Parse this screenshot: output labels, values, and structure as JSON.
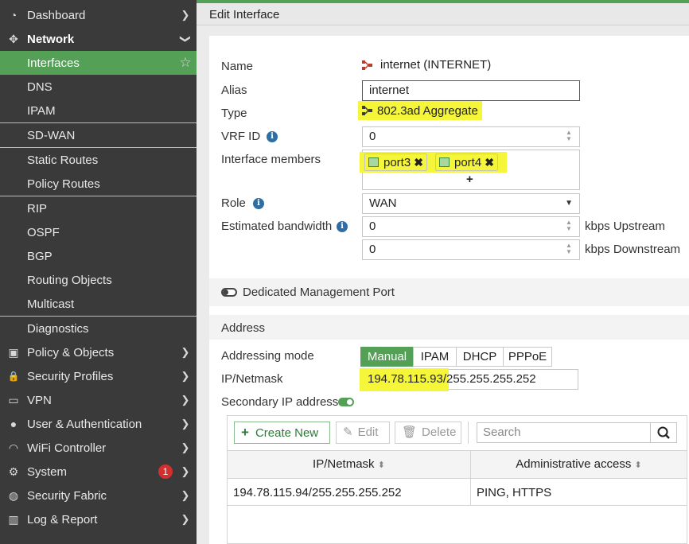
{
  "sidebar": {
    "items": [
      {
        "label": "Dashboard",
        "icon": "dashboard-icon",
        "glyph": "◔"
      },
      {
        "label": "Network",
        "icon": "network-icon",
        "glyph": "✥"
      },
      {
        "label": "Interfaces"
      },
      {
        "label": "DNS"
      },
      {
        "label": "IPAM"
      },
      {
        "label": "SD-WAN"
      },
      {
        "label": "Static Routes"
      },
      {
        "label": "Policy Routes"
      },
      {
        "label": "RIP"
      },
      {
        "label": "OSPF"
      },
      {
        "label": "BGP"
      },
      {
        "label": "Routing Objects"
      },
      {
        "label": "Multicast"
      },
      {
        "label": "Diagnostics"
      },
      {
        "label": "Policy & Objects",
        "icon": "policy-objects-icon",
        "glyph": "▣"
      },
      {
        "label": "Security Profiles",
        "icon": "lock-icon",
        "glyph": "🔒"
      },
      {
        "label": "VPN",
        "icon": "laptop-icon",
        "glyph": "▭"
      },
      {
        "label": "User & Authentication",
        "icon": "user-icon",
        "glyph": "●"
      },
      {
        "label": "WiFi Controller",
        "icon": "wifi-icon",
        "glyph": "◠"
      },
      {
        "label": "System",
        "icon": "gear-icon",
        "glyph": "⚙",
        "badge": "1"
      },
      {
        "label": "Security Fabric",
        "icon": "fabric-icon",
        "glyph": "◍"
      },
      {
        "label": "Log & Report",
        "icon": "bar-chart-icon",
        "glyph": "▥"
      }
    ],
    "favorite_icon": "star-icon",
    "accent": "#53a056"
  },
  "header": {
    "title": "Edit Interface"
  },
  "form": {
    "name_label": "Name",
    "name_value": "internet (INTERNET)",
    "alias_label": "Alias",
    "alias_value": "internet",
    "type_label": "Type",
    "type_value": "802.3ad Aggregate",
    "vrf_label": "VRF ID",
    "vrf_value": "0",
    "members_label": "Interface members",
    "members": [
      "port3",
      "port4"
    ],
    "add_glyph": "+",
    "role_label": "Role",
    "role_value": "WAN",
    "bandwidth_label": "Estimated bandwidth",
    "upstream_value": "0",
    "upstream_unit": "kbps Upstream",
    "downstream_value": "0",
    "downstream_unit": "kbps Downstream",
    "dedicated_mgmt_label": "Dedicated Management Port"
  },
  "address": {
    "section_title": "Address",
    "mode_label": "Addressing mode",
    "modes": [
      "Manual",
      "IPAM",
      "DHCP",
      "PPPoE"
    ],
    "selected_mode": "Manual",
    "ipmask_label": "IP/Netmask",
    "ip_value": "194.78.115.93",
    "mask_value": "/255.255.255.252",
    "secondary_label": "Secondary IP address"
  },
  "secondary_table": {
    "create_label": "Create New",
    "edit_label": "Edit",
    "delete_label": "Delete",
    "search_placeholder": "Search",
    "columns": [
      "IP/Netmask",
      "Administrative access"
    ],
    "rows": [
      {
        "ip": "194.78.115.94/255.255.255.252",
        "access": "PING, HTTPS"
      }
    ]
  },
  "colors": {
    "highlight": "#f5f53a",
    "info": "#2f6ea5",
    "badge": "#d32f2f"
  }
}
